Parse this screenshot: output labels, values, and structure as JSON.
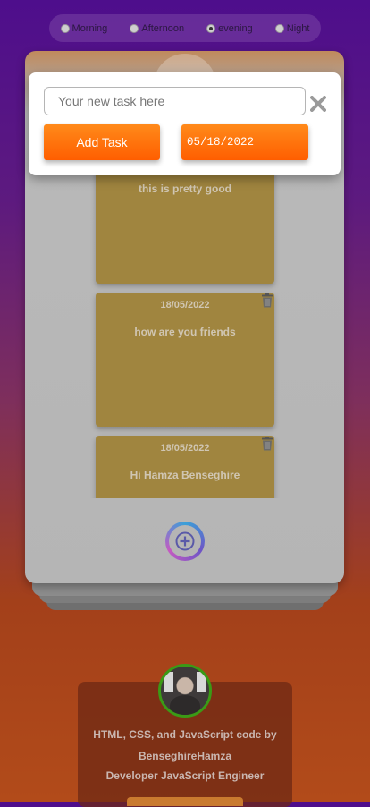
{
  "time_options": [
    {
      "label": "Morning",
      "checked": false
    },
    {
      "label": "Afternoon",
      "checked": false
    },
    {
      "label": "evening",
      "checked": true
    },
    {
      "label": "Night",
      "checked": false
    }
  ],
  "modal": {
    "input_placeholder": "Your new task here",
    "input_value": "",
    "add_task_label": "Add Task",
    "date_value": "05/18/2022"
  },
  "tasks": [
    {
      "date": "",
      "text": "this is pretty good"
    },
    {
      "date": "18/05/2022",
      "text": "how are you friends"
    },
    {
      "date": "18/05/2022",
      "text": "Hi Hamza Benseghire"
    }
  ],
  "footer": {
    "line1": "HTML, CSS, and JavaScript code by",
    "line2": "BenseghireHamza",
    "line3": "Developer JavaScript Engineer"
  },
  "colors": {
    "accent_orange": "#ff6a00",
    "note": "#a0853f",
    "avatar_ring": "#3b9a16"
  }
}
